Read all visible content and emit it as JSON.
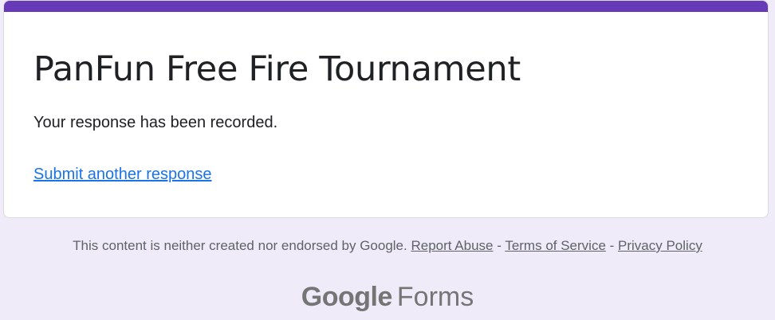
{
  "form": {
    "title": "PanFun Free Fire Tournament",
    "confirmation": "Your response has been recorded.",
    "submit_another": "Submit another response"
  },
  "footer": {
    "disclaimer": "This content is neither created nor endorsed by Google.",
    "report_abuse": "Report Abuse",
    "separator_1": " - ",
    "terms": "Terms of Service",
    "separator_2": " - ",
    "privacy": "Privacy Policy"
  },
  "brand": {
    "google": "Google",
    "forms": "Forms"
  },
  "colors": {
    "accent": "#673ab7",
    "page_background": "#f0ebf8",
    "link": "#1a73e8"
  }
}
